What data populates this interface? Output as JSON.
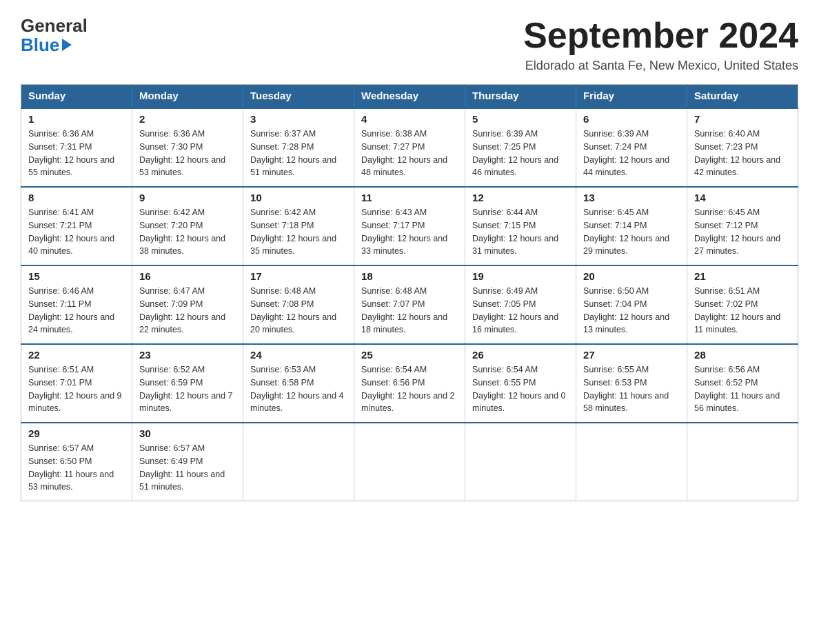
{
  "header": {
    "logo_general": "General",
    "logo_blue": "Blue",
    "month_title": "September 2024",
    "location": "Eldorado at Santa Fe, New Mexico, United States"
  },
  "weekdays": [
    "Sunday",
    "Monday",
    "Tuesday",
    "Wednesday",
    "Thursday",
    "Friday",
    "Saturday"
  ],
  "weeks": [
    [
      {
        "day": "1",
        "sunrise": "6:36 AM",
        "sunset": "7:31 PM",
        "daylight": "12 hours and 55 minutes."
      },
      {
        "day": "2",
        "sunrise": "6:36 AM",
        "sunset": "7:30 PM",
        "daylight": "12 hours and 53 minutes."
      },
      {
        "day": "3",
        "sunrise": "6:37 AM",
        "sunset": "7:28 PM",
        "daylight": "12 hours and 51 minutes."
      },
      {
        "day": "4",
        "sunrise": "6:38 AM",
        "sunset": "7:27 PM",
        "daylight": "12 hours and 48 minutes."
      },
      {
        "day": "5",
        "sunrise": "6:39 AM",
        "sunset": "7:25 PM",
        "daylight": "12 hours and 46 minutes."
      },
      {
        "day": "6",
        "sunrise": "6:39 AM",
        "sunset": "7:24 PM",
        "daylight": "12 hours and 44 minutes."
      },
      {
        "day": "7",
        "sunrise": "6:40 AM",
        "sunset": "7:23 PM",
        "daylight": "12 hours and 42 minutes."
      }
    ],
    [
      {
        "day": "8",
        "sunrise": "6:41 AM",
        "sunset": "7:21 PM",
        "daylight": "12 hours and 40 minutes."
      },
      {
        "day": "9",
        "sunrise": "6:42 AM",
        "sunset": "7:20 PM",
        "daylight": "12 hours and 38 minutes."
      },
      {
        "day": "10",
        "sunrise": "6:42 AM",
        "sunset": "7:18 PM",
        "daylight": "12 hours and 35 minutes."
      },
      {
        "day": "11",
        "sunrise": "6:43 AM",
        "sunset": "7:17 PM",
        "daylight": "12 hours and 33 minutes."
      },
      {
        "day": "12",
        "sunrise": "6:44 AM",
        "sunset": "7:15 PM",
        "daylight": "12 hours and 31 minutes."
      },
      {
        "day": "13",
        "sunrise": "6:45 AM",
        "sunset": "7:14 PM",
        "daylight": "12 hours and 29 minutes."
      },
      {
        "day": "14",
        "sunrise": "6:45 AM",
        "sunset": "7:12 PM",
        "daylight": "12 hours and 27 minutes."
      }
    ],
    [
      {
        "day": "15",
        "sunrise": "6:46 AM",
        "sunset": "7:11 PM",
        "daylight": "12 hours and 24 minutes."
      },
      {
        "day": "16",
        "sunrise": "6:47 AM",
        "sunset": "7:09 PM",
        "daylight": "12 hours and 22 minutes."
      },
      {
        "day": "17",
        "sunrise": "6:48 AM",
        "sunset": "7:08 PM",
        "daylight": "12 hours and 20 minutes."
      },
      {
        "day": "18",
        "sunrise": "6:48 AM",
        "sunset": "7:07 PM",
        "daylight": "12 hours and 18 minutes."
      },
      {
        "day": "19",
        "sunrise": "6:49 AM",
        "sunset": "7:05 PM",
        "daylight": "12 hours and 16 minutes."
      },
      {
        "day": "20",
        "sunrise": "6:50 AM",
        "sunset": "7:04 PM",
        "daylight": "12 hours and 13 minutes."
      },
      {
        "day": "21",
        "sunrise": "6:51 AM",
        "sunset": "7:02 PM",
        "daylight": "12 hours and 11 minutes."
      }
    ],
    [
      {
        "day": "22",
        "sunrise": "6:51 AM",
        "sunset": "7:01 PM",
        "daylight": "12 hours and 9 minutes."
      },
      {
        "day": "23",
        "sunrise": "6:52 AM",
        "sunset": "6:59 PM",
        "daylight": "12 hours and 7 minutes."
      },
      {
        "day": "24",
        "sunrise": "6:53 AM",
        "sunset": "6:58 PM",
        "daylight": "12 hours and 4 minutes."
      },
      {
        "day": "25",
        "sunrise": "6:54 AM",
        "sunset": "6:56 PM",
        "daylight": "12 hours and 2 minutes."
      },
      {
        "day": "26",
        "sunrise": "6:54 AM",
        "sunset": "6:55 PM",
        "daylight": "12 hours and 0 minutes."
      },
      {
        "day": "27",
        "sunrise": "6:55 AM",
        "sunset": "6:53 PM",
        "daylight": "11 hours and 58 minutes."
      },
      {
        "day": "28",
        "sunrise": "6:56 AM",
        "sunset": "6:52 PM",
        "daylight": "11 hours and 56 minutes."
      }
    ],
    [
      {
        "day": "29",
        "sunrise": "6:57 AM",
        "sunset": "6:50 PM",
        "daylight": "11 hours and 53 minutes."
      },
      {
        "day": "30",
        "sunrise": "6:57 AM",
        "sunset": "6:49 PM",
        "daylight": "11 hours and 51 minutes."
      },
      null,
      null,
      null,
      null,
      null
    ]
  ]
}
